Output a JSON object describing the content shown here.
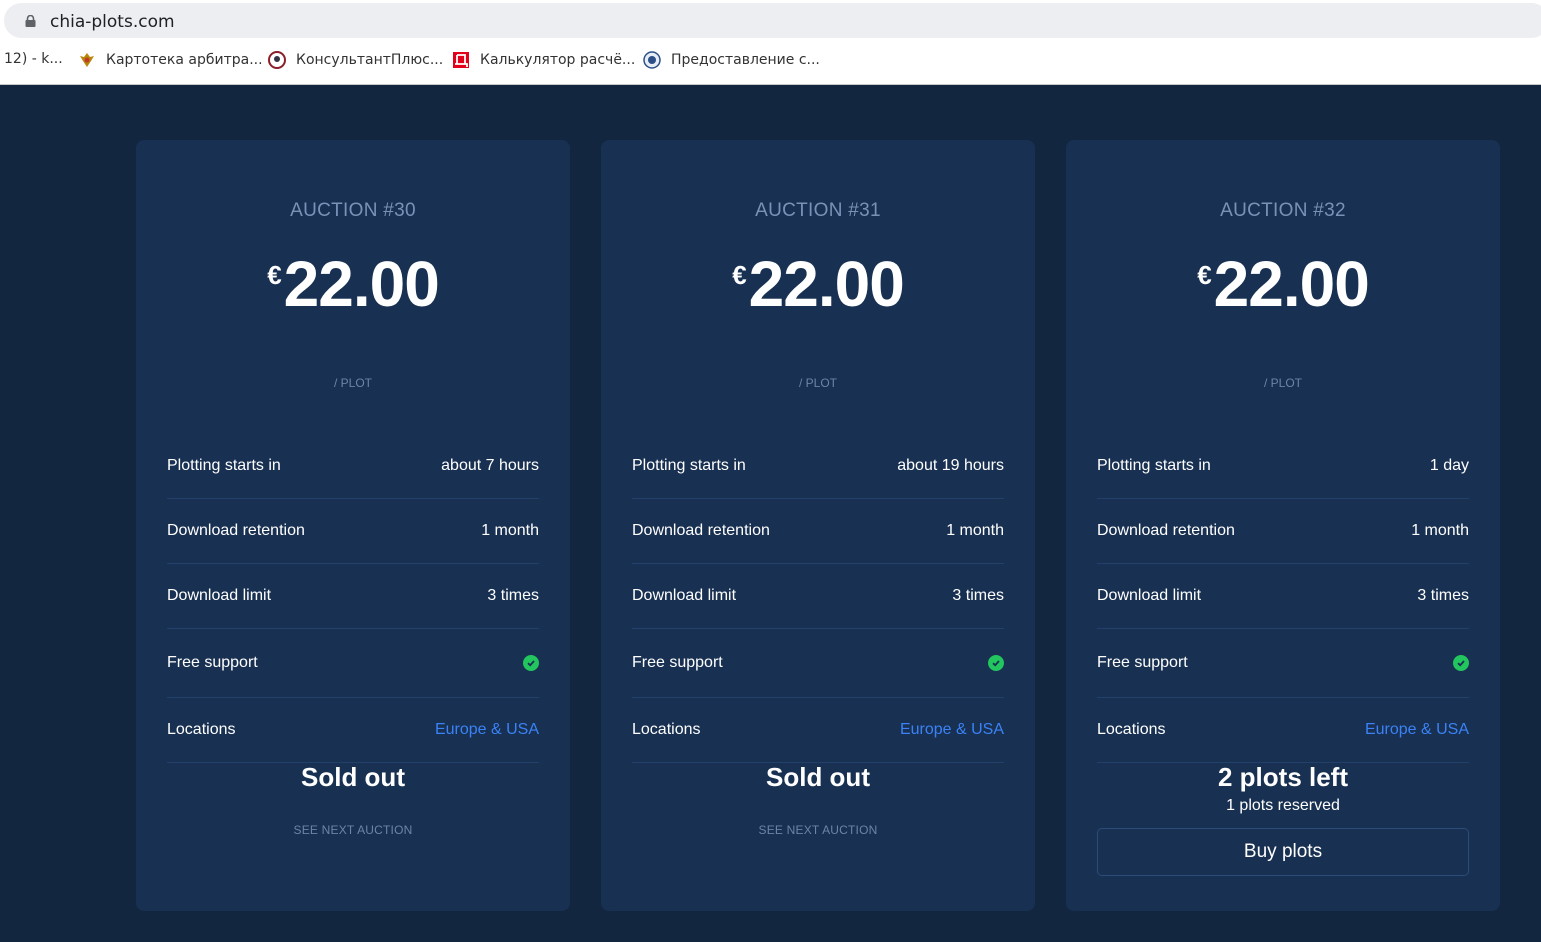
{
  "browser": {
    "url": "chia-plots.com",
    "bookmarks": [
      {
        "label": "12) - k...",
        "icon": "none"
      },
      {
        "label": "Картотека арбитра...",
        "icon": "eagle-emblem-icon"
      },
      {
        "label": "КонсультантПлюс...",
        "icon": "consultant-icon"
      },
      {
        "label": "Калькулятор расчё...",
        "icon": "red-d-icon"
      },
      {
        "label": "Предоставление с...",
        "icon": "seal-icon"
      }
    ]
  },
  "row_labels": {
    "plotting": "Plotting starts in",
    "retention": "Download retention",
    "limit": "Download limit",
    "support": "Free support",
    "locations": "Locations"
  },
  "cards": [
    {
      "title": "AUCTION #30",
      "currency": "€",
      "price": "22.00",
      "per": "/ PLOT",
      "plotting": "about 7 hours",
      "retention": "1 month",
      "limit": "3 times",
      "support": true,
      "locations": "Europe & USA",
      "status": "Sold out",
      "link": "SEE NEXT AUCTION"
    },
    {
      "title": "AUCTION #31",
      "currency": "€",
      "price": "22.00",
      "per": "/ PLOT",
      "plotting": "about 19 hours",
      "retention": "1 month",
      "limit": "3 times",
      "support": true,
      "locations": "Europe & USA",
      "status": "Sold out",
      "link": "SEE NEXT AUCTION"
    },
    {
      "title": "AUCTION #32",
      "currency": "€",
      "price": "22.00",
      "per": "/ PLOT",
      "plotting": "1 day",
      "retention": "1 month",
      "limit": "3 times",
      "support": true,
      "locations": "Europe & USA",
      "status": "2 plots left",
      "reserved": "1 plots reserved",
      "button": "Buy plots"
    }
  ],
  "colors": {
    "page_bg": "#132640",
    "card_bg": "#183051",
    "accent_link": "#3b82f6",
    "check_green": "#22c55e"
  }
}
